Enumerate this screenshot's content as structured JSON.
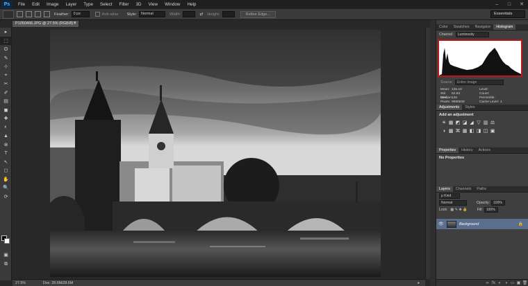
{
  "app": {
    "logo": "Ps",
    "colors": {
      "accent": "#c0141b",
      "selected_layer": "#5a6e8e"
    }
  },
  "menu": [
    "File",
    "Edit",
    "Image",
    "Layer",
    "Type",
    "Select",
    "Filter",
    "3D",
    "View",
    "Window",
    "Help"
  ],
  "window_buttons": [
    "–",
    "□",
    "✕"
  ],
  "options": {
    "feather_label": "Feather:",
    "feather_value": "0 px",
    "antialias_label": "Anti-alias",
    "style_label": "Style:",
    "style_value": "Normal",
    "width_label": "Width:",
    "height_label": "Height:",
    "refine_label": "Refine Edge...",
    "workspace": "Essentials"
  },
  "document": {
    "tab_label": "P1050466.JPG @ 27.5% (RGB/8) *",
    "close": "✕"
  },
  "tools": [
    "▸",
    "⬚",
    "ʘ",
    "✎",
    "⊹",
    "⌖",
    "✂",
    "✐",
    "▤",
    "◼",
    "✚",
    "◐",
    "▲",
    "⊗",
    "T",
    "↖",
    "◻",
    "✋",
    "🔍",
    "⟳",
    "▣",
    "⧉"
  ],
  "status": {
    "zoom": "27.5%",
    "doc": "Doc: 28.6M/28.6M",
    "arrow": "▸"
  },
  "histogram_panel": {
    "tabs": [
      "Color",
      "Swatches",
      "Navigator",
      "Histogram"
    ],
    "channel_label": "Channel:",
    "channel_value": "Luminosity",
    "source_label": "Source:",
    "source_value": "Entire Image",
    "stats": [
      {
        "k": "Mean:",
        "v": "136.19",
        "k2": "Level:",
        "v2": ""
      },
      {
        "k": "Std Dev:",
        "v": "62.83",
        "k2": "Count:",
        "v2": ""
      },
      {
        "k": "Median:",
        "v": "136",
        "k2": "Percentile:",
        "v2": ""
      },
      {
        "k": "Pixels:",
        "v": "9980928",
        "k2": "Cache Level:",
        "v2": "1"
      }
    ]
  },
  "adjustments_panel": {
    "tabs": [
      "Adjustments",
      "Styles"
    ],
    "title": "Add an adjustment",
    "icons": [
      "☀",
      "▦",
      "◩",
      "◪",
      "◢",
      "▽",
      "▥",
      "⚖",
      "◑",
      "▩",
      "⌘",
      "▦",
      "◧",
      "◨",
      "◫",
      "▣"
    ]
  },
  "properties_panel": {
    "tabs": [
      "Properties",
      "History",
      "Actions"
    ],
    "text": "No Properties"
  },
  "layers_panel": {
    "tabs": [
      "Layers",
      "Channels",
      "Paths"
    ],
    "kind": "ρ Kind",
    "blend": "Normal",
    "opacity_label": "Opacity:",
    "opacity_value": "100%",
    "lock_label": "Lock:",
    "fill_label": "Fill:",
    "fill_value": "100%",
    "layer_name": "Background",
    "eye": "👁",
    "lock": "🔒",
    "bottom_icons": [
      "∞",
      "fx",
      "◐",
      "◑",
      "▭",
      "▣",
      "🗑"
    ]
  }
}
